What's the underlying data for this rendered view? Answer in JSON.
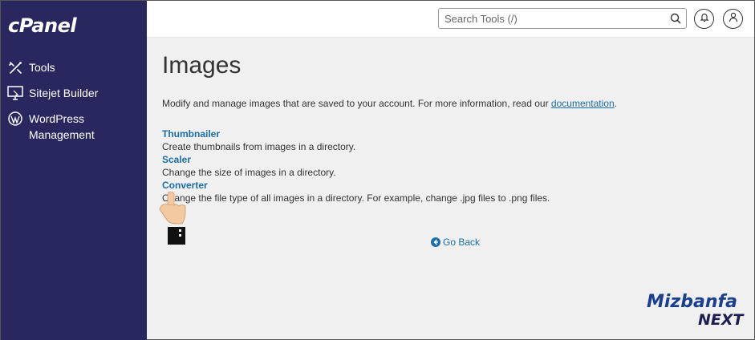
{
  "sidebar": {
    "logo": "cPanel",
    "items": [
      {
        "label": "Tools",
        "icon": "tools-icon"
      },
      {
        "label": "Sitejet Builder",
        "icon": "sitejet-monitor-icon"
      },
      {
        "label": "WordPress Management",
        "label_line1": "WordPress",
        "label_line2": "Management",
        "icon": "wordpress-icon"
      }
    ]
  },
  "header": {
    "search_placeholder": "Search Tools (/)"
  },
  "main": {
    "title": "Images",
    "intro_text": "Modify and manage images that are saved to your account. For more information, read our ",
    "intro_link": "documentation",
    "intro_end": ".",
    "tools": [
      {
        "name": "Thumbnailer",
        "description": "Create thumbnails from images in a directory."
      },
      {
        "name": "Scaler",
        "description": "Change the size of images in a directory."
      },
      {
        "name": "Converter",
        "description": "Change the file type of all images in a directory. For example, change .jpg files to .png files."
      }
    ],
    "go_back": "Go Back"
  },
  "watermark": {
    "line1": "Mizbanfa",
    "line2": "NEXT"
  },
  "colors": {
    "sidebar_bg": "#28285e",
    "link": "#1b6ea8",
    "brand_blue": "#1a3f8f",
    "brand_dark": "#1d1d4f"
  }
}
